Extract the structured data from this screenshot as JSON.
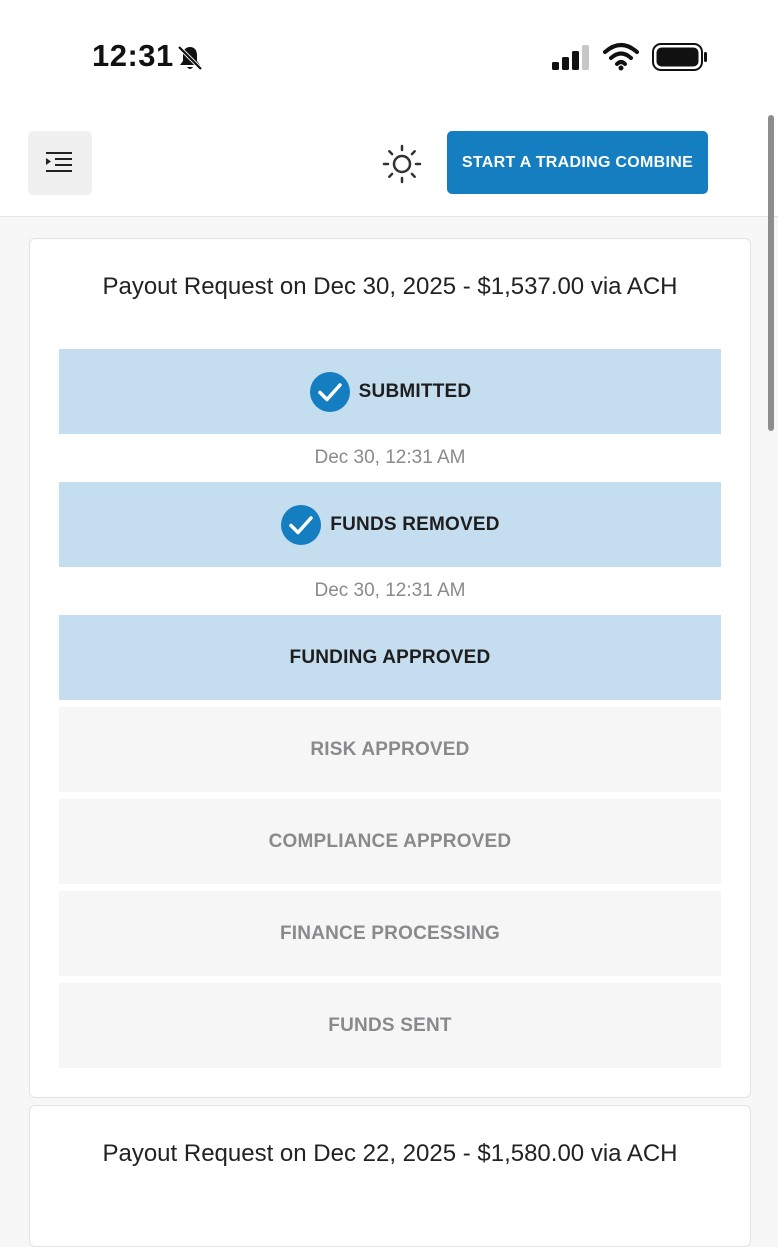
{
  "status_bar": {
    "time": "12:31",
    "icons": [
      "bell-slash-icon",
      "signal-icon",
      "wifi-icon",
      "battery-icon"
    ]
  },
  "header": {
    "menu_icon": "menu-indent-icon",
    "theme_icon": "sun-icon",
    "cta_label": "START A TRADING COMBINE"
  },
  "colors": {
    "accent": "#147ec1",
    "done_step_bg": "#c4ddef",
    "pending_step_bg": "#f6f6f7",
    "muted_text": "#8a8a8c"
  },
  "payouts": [
    {
      "title": "Payout Request on Dec 30, 2025 - $1,537.00 via ACH",
      "steps": [
        {
          "label": "SUBMITTED",
          "state": "done",
          "checked": true,
          "timestamp": "Dec 30, 12:31 AM"
        },
        {
          "label": "FUNDS REMOVED",
          "state": "done",
          "checked": true,
          "timestamp": "Dec 30, 12:31 AM"
        },
        {
          "label": "FUNDING APPROVED",
          "state": "done",
          "checked": false,
          "timestamp": ""
        },
        {
          "label": "RISK APPROVED",
          "state": "pending",
          "checked": false,
          "timestamp": ""
        },
        {
          "label": "COMPLIANCE APPROVED",
          "state": "pending",
          "checked": false,
          "timestamp": ""
        },
        {
          "label": "FINANCE PROCESSING",
          "state": "pending",
          "checked": false,
          "timestamp": ""
        },
        {
          "label": "FUNDS SENT",
          "state": "pending",
          "checked": false,
          "timestamp": ""
        }
      ]
    },
    {
      "title": "Payout Request on Dec 22, 2025 - $1,580.00 via ACH"
    }
  ]
}
